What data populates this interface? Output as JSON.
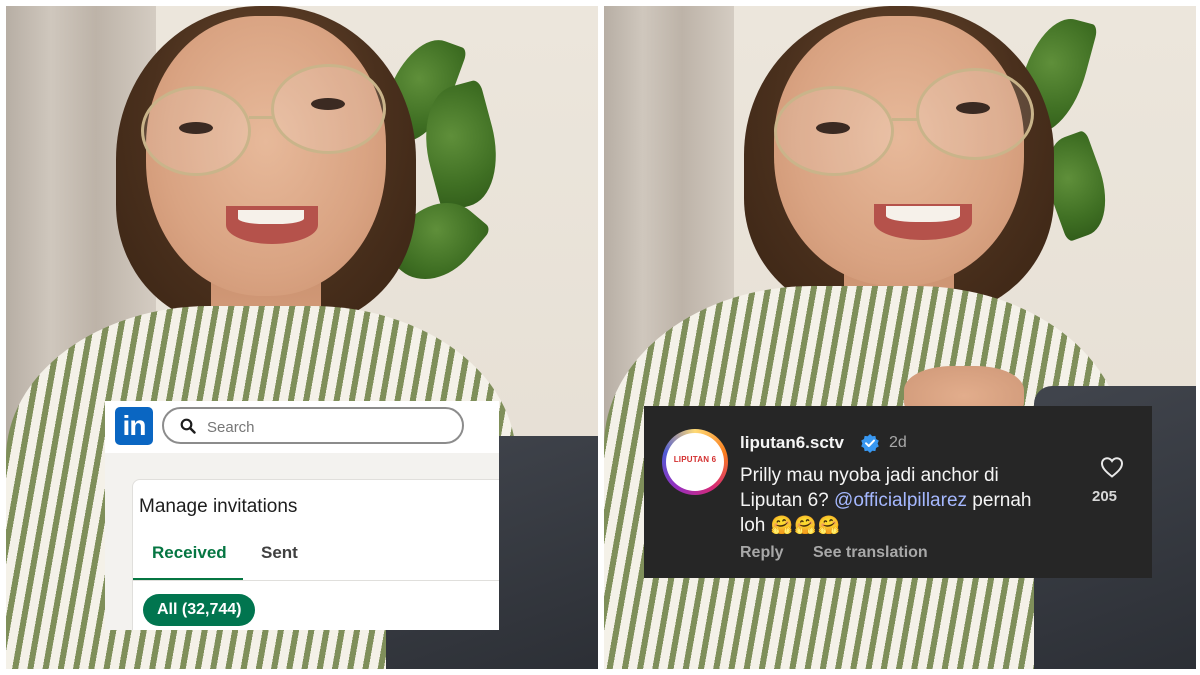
{
  "linkedin": {
    "logo_text": "in",
    "search": {
      "placeholder": "Search"
    },
    "section_title": "Manage invitations",
    "tabs": [
      {
        "label": "Received",
        "active": true
      },
      {
        "label": "Sent",
        "active": false
      }
    ],
    "filter_pill": "All (32,744)",
    "colors": {
      "brand": "#0a66c2",
      "accent": "#057642",
      "pill": "#01754f"
    }
  },
  "instagram_comment": {
    "avatar_text": "LIPUTAN 6",
    "username": "liputan6.sctv",
    "verified": true,
    "time_ago": "2d",
    "text_before_mention": "Prilly mau nyoba jadi anchor di Liputan 6? ",
    "mention": "@officialpillarez",
    "text_after_mention": " pernah loh ",
    "emojis": "🤗🤗🤗",
    "reply_label": "Reply",
    "translation_label": "See translation",
    "like_count": "205",
    "colors": {
      "background": "#262626",
      "mention": "#a5b8ff",
      "verified": "#3897f0"
    }
  },
  "icons": {
    "search": "search-icon",
    "verified": "verified-badge-icon",
    "like": "heart-outline-icon"
  }
}
